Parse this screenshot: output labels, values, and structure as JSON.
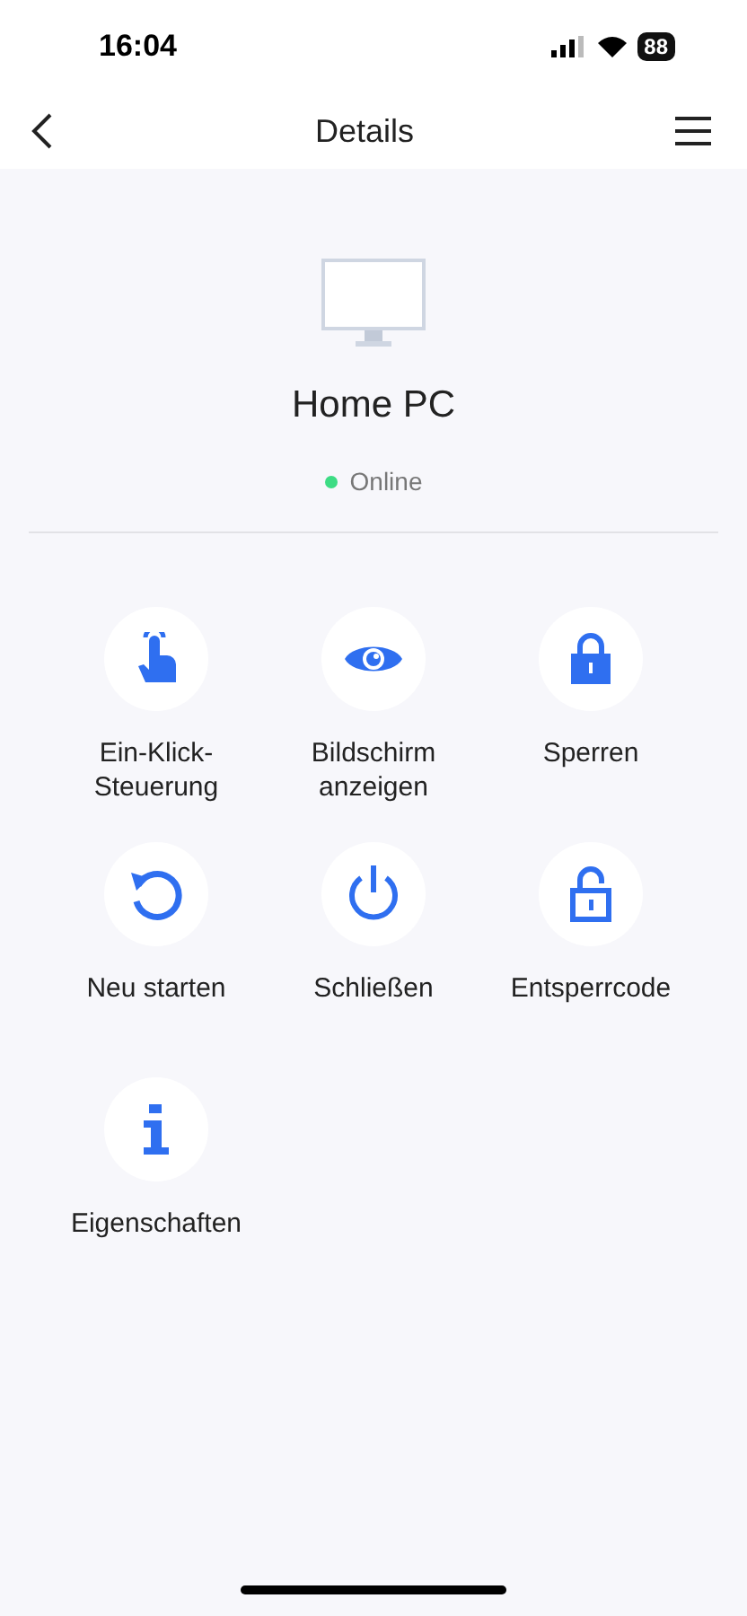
{
  "status_bar": {
    "time": "16:04",
    "battery": "88"
  },
  "header": {
    "title": "Details"
  },
  "device": {
    "name": "Home PC",
    "status": {
      "text": "Online",
      "color": "#3ddc84"
    }
  },
  "actions": [
    {
      "kind": "tap",
      "label": "Ein-Klick-Steuerung"
    },
    {
      "kind": "eye",
      "label": "Bildschirm anzeigen"
    },
    {
      "kind": "lock",
      "label": "Sperren"
    },
    {
      "kind": "restart",
      "label": "Neu starten"
    },
    {
      "kind": "power",
      "label": "Schließen"
    },
    {
      "kind": "unlock",
      "label": "Entsperrcode"
    },
    {
      "kind": "info",
      "label": "Eigenschaften"
    }
  ]
}
